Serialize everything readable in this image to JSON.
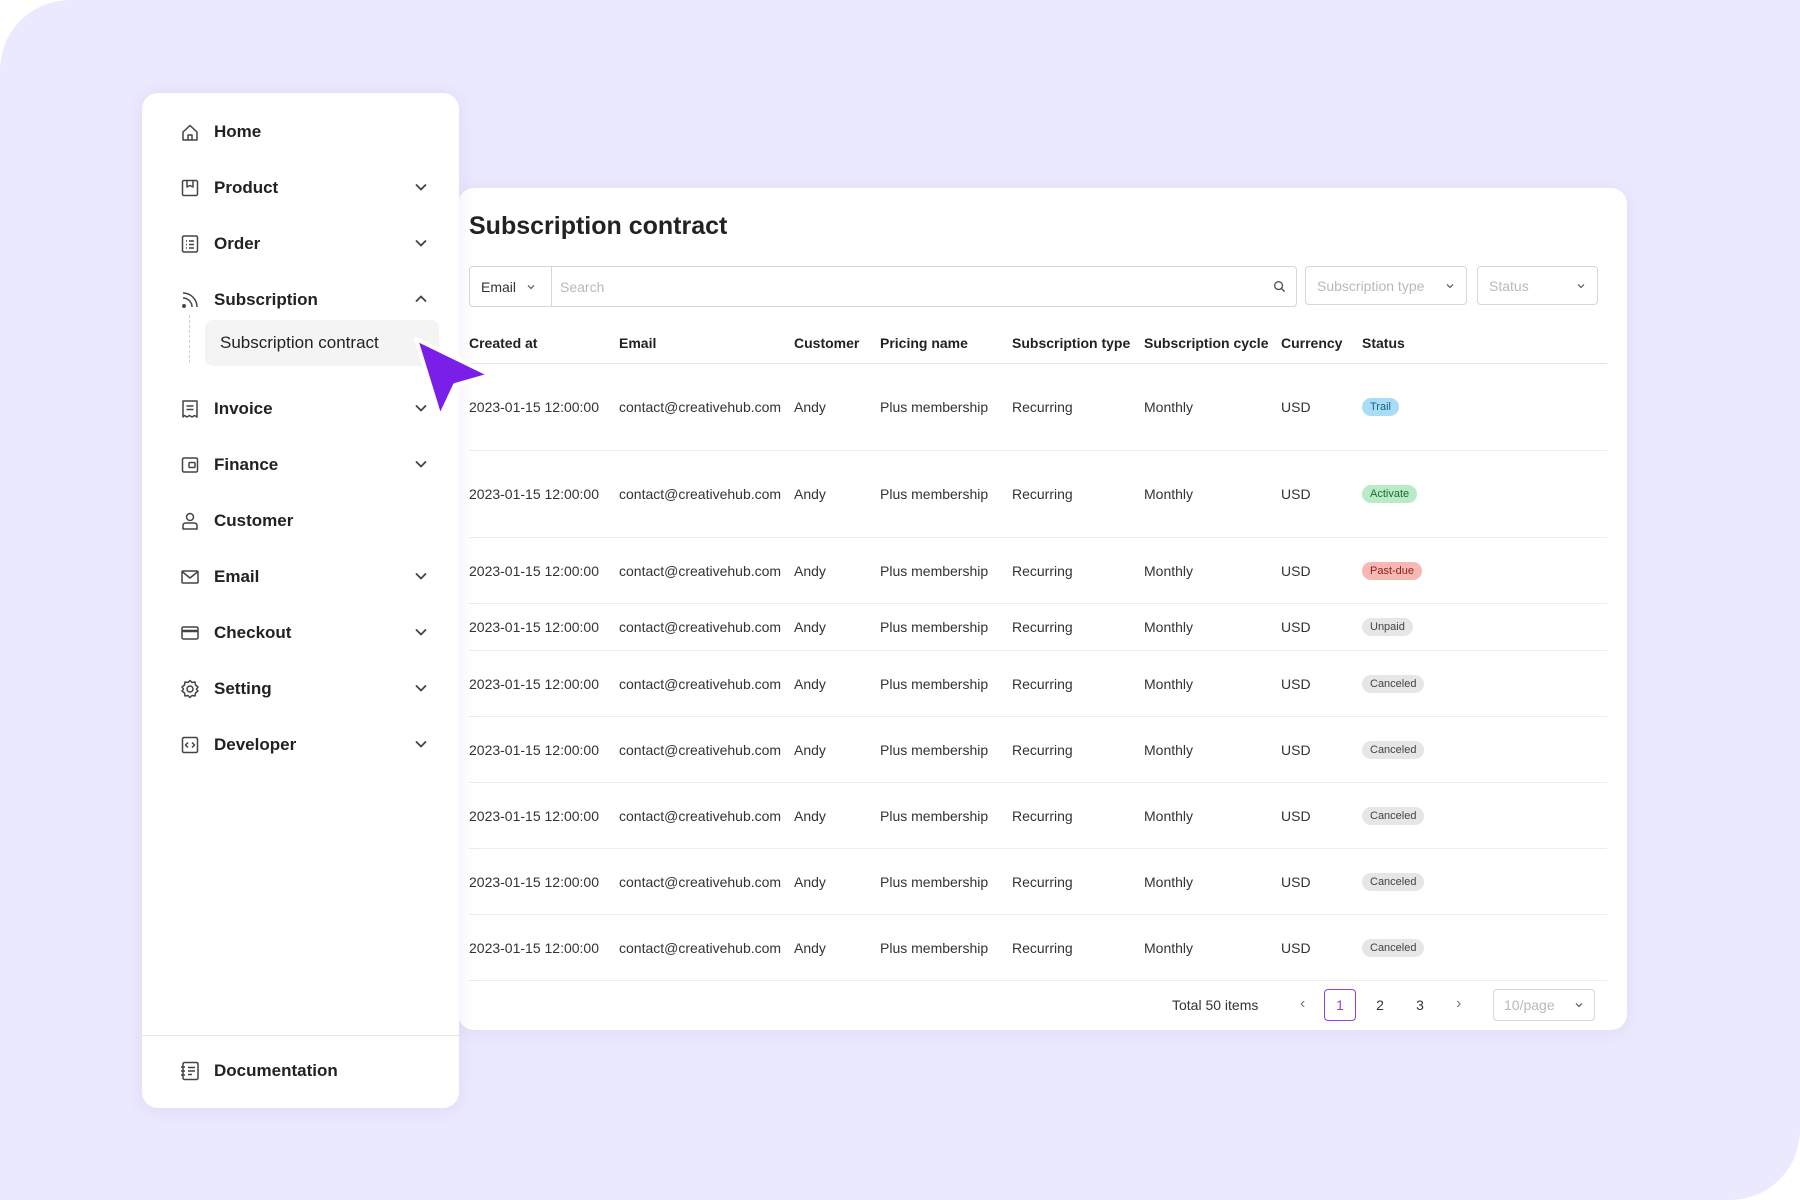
{
  "sidebar": {
    "items": [
      {
        "label": "Home",
        "icon": "home-icon",
        "chevron": ""
      },
      {
        "label": "Product",
        "icon": "product-icon",
        "chevron": "down"
      },
      {
        "label": "Order",
        "icon": "order-icon",
        "chevron": "down"
      },
      {
        "label": "Subscription",
        "icon": "rss-icon",
        "chevron": "up"
      },
      {
        "label": "Invoice",
        "icon": "invoice-icon",
        "chevron": "down"
      },
      {
        "label": "Finance",
        "icon": "wallet-icon",
        "chevron": "down"
      },
      {
        "label": "Customer",
        "icon": "user-icon",
        "chevron": ""
      },
      {
        "label": "Email",
        "icon": "mail-icon",
        "chevron": "down"
      },
      {
        "label": "Checkout",
        "icon": "card-icon",
        "chevron": "down"
      },
      {
        "label": "Setting",
        "icon": "gear-icon",
        "chevron": "down"
      },
      {
        "label": "Developer",
        "icon": "code-icon",
        "chevron": "down"
      }
    ],
    "subitem": "Subscription contract",
    "footer": {
      "label": "Documentation",
      "icon": "documentation-icon"
    }
  },
  "main": {
    "title": "Subscription contract",
    "filters": {
      "field": "Email",
      "search_placeholder": "Search",
      "subscription_type_placeholder": "Subscription type",
      "status_placeholder": "Status"
    },
    "columns": [
      "Created at",
      "Email",
      "Customer",
      "Pricing name",
      "Subscription type",
      "Subscription cycle",
      "Currency",
      "Status"
    ],
    "rows": [
      {
        "created": "2023-01-15 12:00:00",
        "email": "contact@creativehub.com",
        "customer": "Andy",
        "pricing": "Plus membership",
        "type": "Recurring",
        "cycle": "Monthly",
        "currency": "USD",
        "status": "Trail"
      },
      {
        "created": "2023-01-15 12:00:00",
        "email": "contact@creativehub.com",
        "customer": "Andy",
        "pricing": "Plus membership",
        "type": "Recurring",
        "cycle": "Monthly",
        "currency": "USD",
        "status": "Activate"
      },
      {
        "created": "2023-01-15 12:00:00",
        "email": "contact@creativehub.com",
        "customer": "Andy",
        "pricing": "Plus membership",
        "type": "Recurring",
        "cycle": "Monthly",
        "currency": "USD",
        "status": "Past-due"
      },
      {
        "created": "2023-01-15 12:00:00",
        "email": "contact@creativehub.com",
        "customer": "Andy",
        "pricing": "Plus membership",
        "type": "Recurring",
        "cycle": "Monthly",
        "currency": "USD",
        "status": "Unpaid"
      },
      {
        "created": "2023-01-15 12:00:00",
        "email": "contact@creativehub.com",
        "customer": "Andy",
        "pricing": "Plus membership",
        "type": "Recurring",
        "cycle": "Monthly",
        "currency": "USD",
        "status": "Canceled"
      },
      {
        "created": "2023-01-15 12:00:00",
        "email": "contact@creativehub.com",
        "customer": "Andy",
        "pricing": "Plus membership",
        "type": "Recurring",
        "cycle": "Monthly",
        "currency": "USD",
        "status": "Canceled"
      },
      {
        "created": "2023-01-15 12:00:00",
        "email": "contact@creativehub.com",
        "customer": "Andy",
        "pricing": "Plus membership",
        "type": "Recurring",
        "cycle": "Monthly",
        "currency": "USD",
        "status": "Canceled"
      },
      {
        "created": "2023-01-15 12:00:00",
        "email": "contact@creativehub.com",
        "customer": "Andy",
        "pricing": "Plus membership",
        "type": "Recurring",
        "cycle": "Monthly",
        "currency": "USD",
        "status": "Canceled"
      },
      {
        "created": "2023-01-15 12:00:00",
        "email": "contact@creativehub.com",
        "customer": "Andy",
        "pricing": "Plus membership",
        "type": "Recurring",
        "cycle": "Monthly",
        "currency": "USD",
        "status": "Canceled"
      }
    ],
    "status_colors": {
      "Trail": {
        "bg": "#a9ddf5",
        "fg": "#1b5f7d"
      },
      "Activate": {
        "bg": "#b8ebc6",
        "fg": "#1e6b36"
      },
      "Past-due": {
        "bg": "#f7b8b3",
        "fg": "#8a231b"
      },
      "Unpaid": {
        "bg": "#e6e6e6",
        "fg": "#444444"
      },
      "Canceled": {
        "bg": "#e6e6e6",
        "fg": "#444444"
      }
    },
    "pagination": {
      "total": "Total 50 items",
      "pages": [
        "1",
        "2",
        "3"
      ],
      "current": "1",
      "page_size": "10/page"
    }
  },
  "accent_color": "#8e3ff2"
}
